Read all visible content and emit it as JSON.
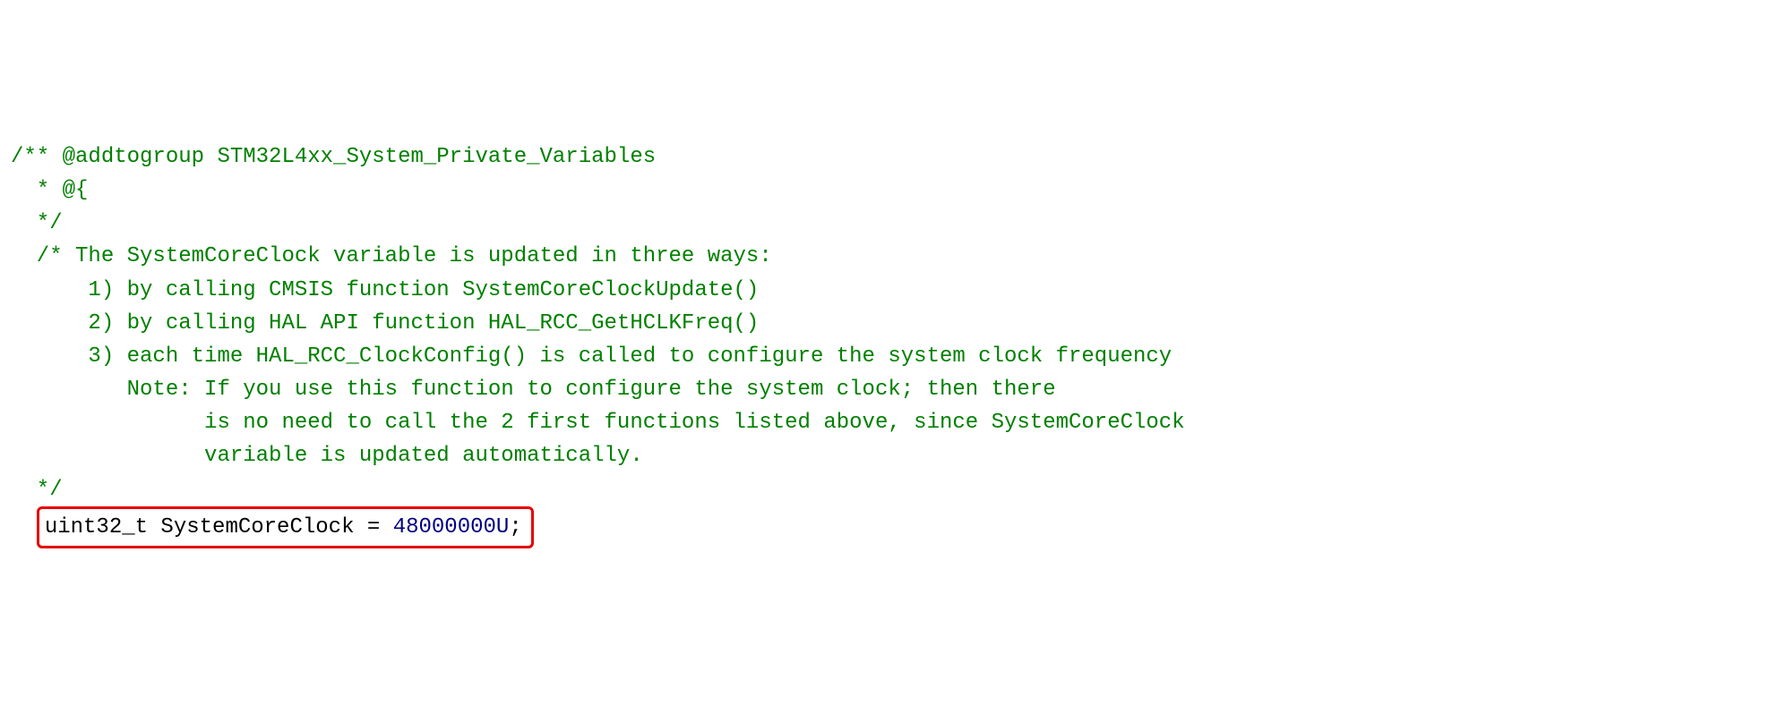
{
  "code": {
    "c1": "/** @addtogroup STM32L4xx_System_Private_Variables",
    "c2": "  * @{",
    "c3": "  */",
    "c4": "  /* The SystemCoreClock variable is updated in three ways:",
    "c5": "      1) by calling CMSIS function SystemCoreClockUpdate()",
    "c6": "      2) by calling HAL API function HAL_RCC_GetHCLKFreq()",
    "c7": "      3) each time HAL_RCC_ClockConfig() is called to configure the system clock frequency",
    "c8": "         Note: If you use this function to configure the system clock; then there",
    "c9": "               is no need to call the 2 first functions listed above, since SystemCoreClock",
    "c10": "               variable is updated automatically.",
    "c11": "  */",
    "decl_indent": "  ",
    "decl_type": "uint32_t",
    "decl_name": " SystemCoreClock ",
    "decl_eq": "= ",
    "decl_value": "48000000U",
    "decl_semi": ";"
  }
}
